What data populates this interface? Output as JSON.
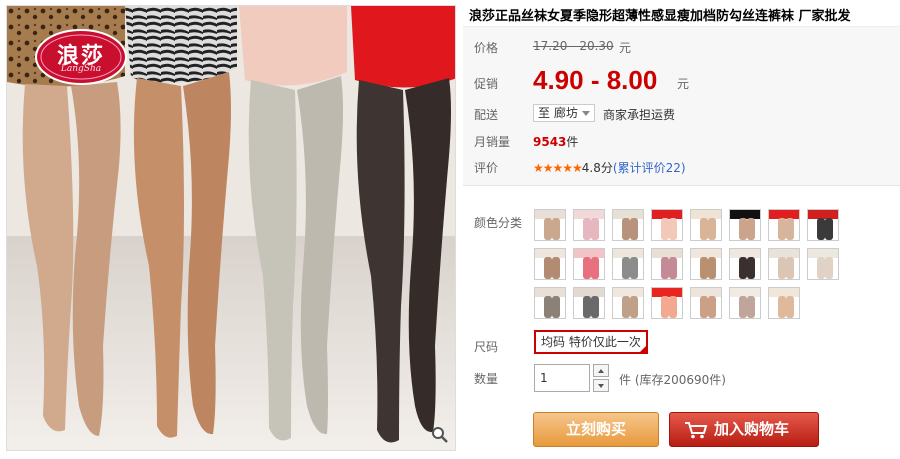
{
  "product": {
    "title": "浪莎正品丝袜女夏季隐形超薄性感显瘦加档防勾丝连裤袜 厂家批发",
    "brand_logo_cn": "浪莎",
    "brand_logo_en": "LangSha"
  },
  "price": {
    "original_label": "价格",
    "original_value": "17.20 - 20.30",
    "original_unit": "元",
    "sale_label": "促销",
    "sale_value": "4.90 - 8.00",
    "sale_unit": "元"
  },
  "shipping": {
    "label": "配送",
    "destination": "至 廊坊",
    "note": "商家承担运费"
  },
  "sales": {
    "label": "月销量",
    "count": "9543",
    "unit": "件"
  },
  "rating": {
    "label": "评价",
    "stars": "★★★★★",
    "score": "4.8分",
    "link": "(累计评价22)"
  },
  "colors": {
    "label": "颜色分类",
    "swatches": [
      {
        "top": "#e8e0d8",
        "leg": "#c9a88d"
      },
      {
        "top": "#f1d9d9",
        "leg": "#e7b7c0"
      },
      {
        "top": "#e6e0d5",
        "leg": "#b8927a"
      },
      {
        "top": "#e02020",
        "leg": "#f2c8b8"
      },
      {
        "top": "#efe3d6",
        "leg": "#d8b498"
      },
      {
        "top": "#111111",
        "leg": "#caa58b"
      },
      {
        "top": "#e02020",
        "leg": "#d7b59c"
      },
      {
        "top": "#d41f1f",
        "leg": "#3a3a3a"
      },
      {
        "top": "#eee6dc",
        "leg": "#b38a72"
      },
      {
        "top": "#f2c4c8",
        "leg": "#e8707f"
      },
      {
        "top": "#ece6dc",
        "leg": "#8c8c8c"
      },
      {
        "top": "#eadfd5",
        "leg": "#c48a96"
      },
      {
        "top": "#f0e6dc",
        "leg": "#b99070"
      },
      {
        "top": "#efe8e0",
        "leg": "#3a3030"
      },
      {
        "top": "#e8e2d8",
        "leg": "#d9c6b4"
      },
      {
        "top": "#ece7df",
        "leg": "#e0d2c4"
      },
      {
        "top": "#e8e0d6",
        "leg": "#8b8177"
      },
      {
        "top": "#e2dad0",
        "leg": "#6a6a6a"
      },
      {
        "top": "#f0e8de",
        "leg": "#bfa089"
      },
      {
        "top": "#e8261f",
        "leg": "#f3a890"
      },
      {
        "top": "#ede5db",
        "leg": "#caa086"
      },
      {
        "top": "#f1ebe3",
        "leg": "#c0a59a"
      },
      {
        "top": "#f1e6da",
        "leg": "#dfb99c"
      }
    ]
  },
  "size": {
    "label": "尺码",
    "option": "均码 特价仅此一次"
  },
  "quantity": {
    "label": "数量",
    "value": "1",
    "unit_stock": "件 (库存200690件)"
  },
  "buttons": {
    "buy": "立刻购买",
    "cart": "加入购物车"
  },
  "accent_colors": {
    "price_red": "#cc0000",
    "buy_orange": "#e79a3c",
    "cart_red": "#b81d12",
    "link_blue": "#3366cc"
  }
}
